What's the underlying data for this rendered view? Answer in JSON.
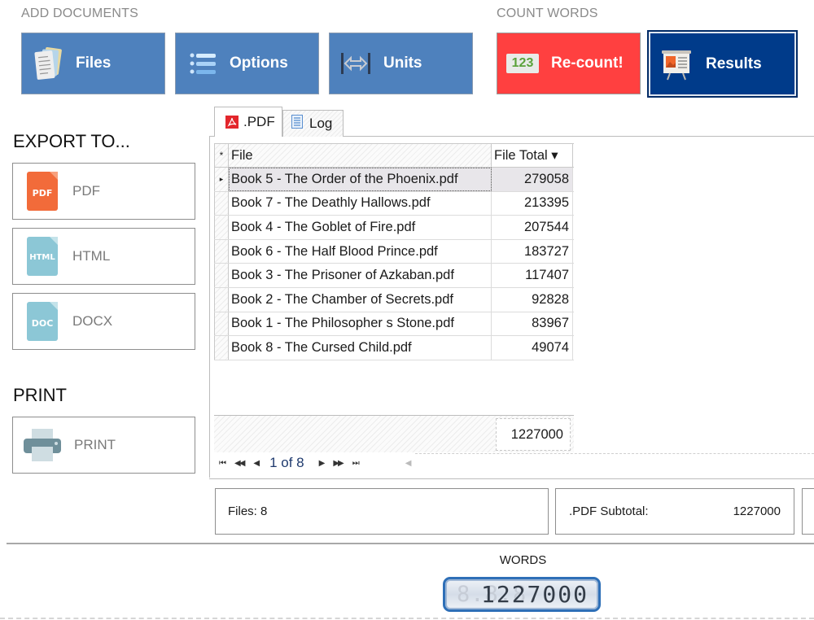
{
  "toolbar": {
    "add_documents_label": "ADD DOCUMENTS",
    "count_words_label": "COUNT WORDS",
    "buttons": [
      {
        "label": "Files",
        "icon": "files-icon"
      },
      {
        "label": "Options",
        "icon": "options-icon"
      },
      {
        "label": "Units",
        "icon": "units-icon"
      },
      {
        "label": "Re-count!",
        "icon": "counter-123-icon",
        "icon_text": "123",
        "color": "#ff4040"
      },
      {
        "label": "Results",
        "icon": "presentation-board-icon",
        "color": "#003b8a"
      }
    ]
  },
  "export": {
    "heading": "EXPORT TO...",
    "items": [
      {
        "label": "PDF",
        "icon_text": "PDF",
        "color": "#f26b3a"
      },
      {
        "label": "HTML",
        "icon_text": "HTML",
        "color": "#8cc7d6"
      },
      {
        "label": "DOCX",
        "icon_text": "DOC",
        "color": "#8cc7d6"
      }
    ]
  },
  "print": {
    "heading": "PRINT",
    "button_label": "PRINT"
  },
  "tabs": [
    {
      "label": ".PDF",
      "icon": "pdf-icon",
      "active": true
    },
    {
      "label": "Log",
      "icon": "log-document-icon",
      "active": false
    }
  ],
  "grid": {
    "columns": {
      "indicator": "*",
      "file": "File",
      "total": "File Total ▾"
    },
    "rows": [
      {
        "file": "Book 5 - The Order of the Phoenix.pdf",
        "total": "279058",
        "selected": true
      },
      {
        "file": "Book 7 - The Deathly Hallows.pdf",
        "total": "213395"
      },
      {
        "file": "Book 4 - The Goblet of Fire.pdf",
        "total": "207544"
      },
      {
        "file": "Book 6 - The Half Blood Prince.pdf",
        "total": "183727"
      },
      {
        "file": "Book 3 - The Prisoner of Azkaban.pdf",
        "total": "117407"
      },
      {
        "file": "Book 2 - The Chamber of Secrets.pdf",
        "total": "92828"
      },
      {
        "file": "Book 1 - The Philosopher s Stone.pdf",
        "total": "83967"
      },
      {
        "file": "Book 8 - The Cursed Child.pdf",
        "total": "49074"
      }
    ],
    "footer_total": "1227000",
    "pager": {
      "first": "⏮",
      "prev_page": "◀◀",
      "prev": "◀",
      "info": "1 of 8",
      "next": "▶",
      "next_page": "▶▶",
      "last": "⏭",
      "scroll_left": "◀"
    }
  },
  "summary": {
    "files_label": "Files: 8",
    "subtotal_label": ".PDF Subtotal:",
    "subtotal_value": "1227000"
  },
  "words": {
    "label": "WORDS",
    "value": "1227000",
    "ghost": "8.8.8."
  }
}
